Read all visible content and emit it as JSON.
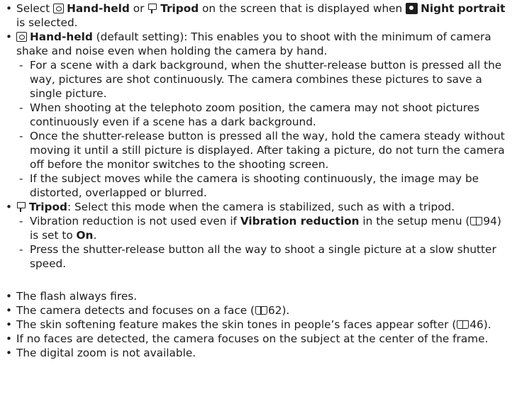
{
  "p1": {
    "t1": "Select ",
    "t2": "Hand-held",
    "t3": " or ",
    "t4": "Tripod",
    "t5": " on the screen that is displayed when ",
    "t6": "Night portrait",
    "t7": " is selected."
  },
  "p2": {
    "t1": "Hand-held",
    "t2": " (default setting): This enables you to shoot with the minimum of camera shake and noise even when holding the camera by hand.",
    "subs": [
      "For a scene with a dark background, when the shutter-release button is pressed all the way, pictures are shot continuously. The camera combines these pictures to save a single picture.",
      "When shooting at the telephoto zoom position, the camera may not shoot pictures continuously even if a scene has a dark background.",
      "Once the shutter-release button is pressed all the way, hold the camera steady without moving it until a still picture is displayed. After taking a picture, do not turn the camera off before the monitor switches to the shooting screen.",
      "If the subject moves while the camera is shooting continuously, the image may be distorted, overlapped or blurred."
    ]
  },
  "p3": {
    "t1": "Tripod",
    "t2": ": Select this mode when the camera is stabilized, such as with a tripod.",
    "sub1": {
      "t1": "Vibration reduction is not used even if ",
      "t2": "Vibration reduction",
      "t3": " in the setup menu (",
      "ref": "94",
      "t4": ") is set to ",
      "t5": "On",
      "t6": "."
    },
    "sub2": "Press the shutter-release button all the way to shoot a single picture at a slow shutter speed."
  },
  "list2": {
    "i1": "The flash always fires.",
    "i2": {
      "t1": "The camera detects and focuses on a face (",
      "ref": "62",
      "t2": ")."
    },
    "i3": {
      "t1": "The skin softening feature makes the skin tones in people’s faces appear softer (",
      "ref": "46",
      "t2": ")."
    },
    "i4": "If no faces are detected, the camera focuses on the subject at the center of the frame.",
    "i5": "The digital zoom is not available."
  },
  "icons": {
    "hand_held": "hand-held-mode-icon",
    "tripod": "tripod-mode-icon",
    "night_portrait": "night-portrait-scene-icon",
    "reference": "manual-page-reference-icon"
  }
}
